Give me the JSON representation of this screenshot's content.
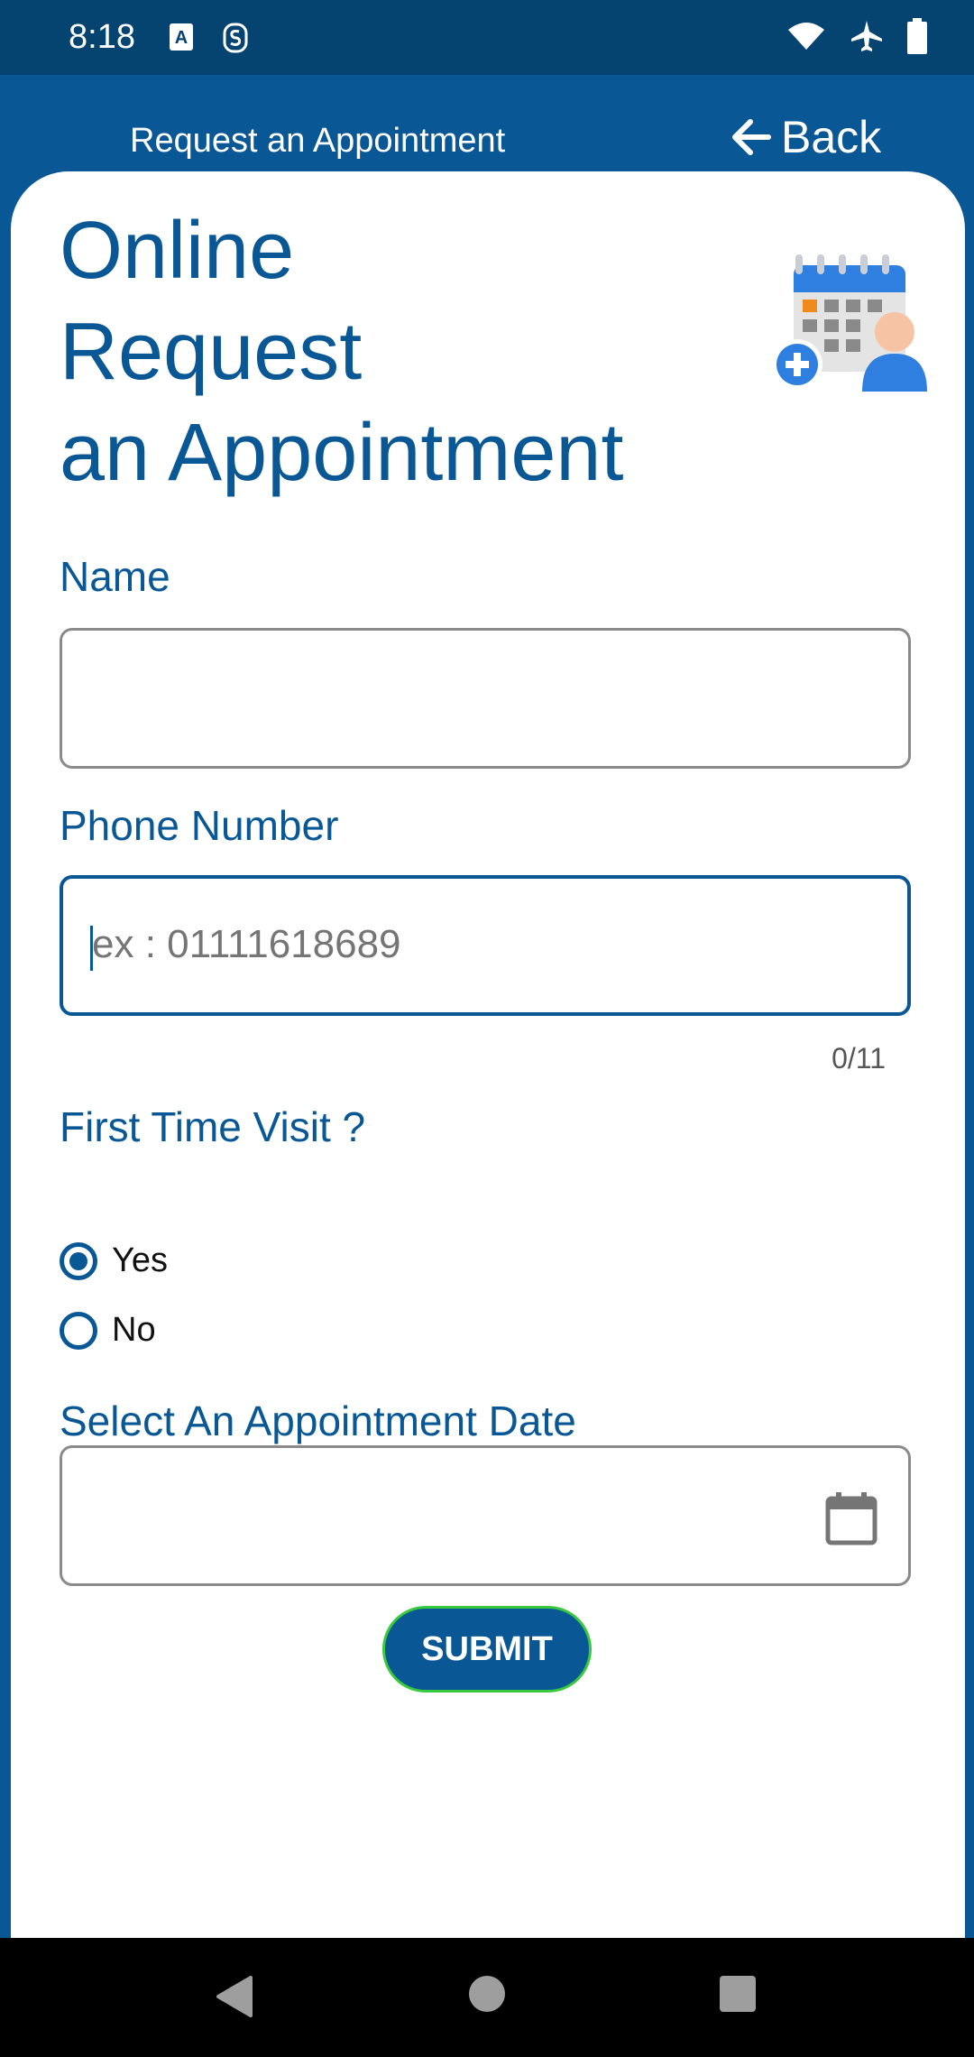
{
  "status_bar": {
    "time": "8:18",
    "left_icons": [
      "text-a-icon",
      "notification-s-icon"
    ],
    "right_icons": [
      "wifi-icon",
      "airplane-icon",
      "battery-icon"
    ]
  },
  "app_bar": {
    "title": "Request an Appointment",
    "back_label": "Back",
    "back_icon": "arrow-left-icon"
  },
  "heading": {
    "line1": "Online",
    "line2": "Request",
    "line3": "an Appointment",
    "illustration_icon": "calendar-person-add-icon"
  },
  "form": {
    "name": {
      "label": "Name",
      "value": ""
    },
    "phone": {
      "label": "Phone Number",
      "placeholder": "ex : 01111618689",
      "counter": "0/11"
    },
    "first_visit": {
      "label": "First Time Visit ?",
      "options": [
        {
          "label": "Yes",
          "checked": true
        },
        {
          "label": "No",
          "checked": false
        }
      ]
    },
    "date": {
      "label": "Select An Appointment Date",
      "value": "",
      "icon": "calendar-icon"
    },
    "submit_label": "SUBMIT"
  },
  "colors": {
    "primary": "#0a5796",
    "status_bar": "#054371",
    "submit_border": "#38c93e"
  },
  "nav_bar": {
    "icons": [
      "back-triangle-icon",
      "home-circle-icon",
      "recents-square-icon"
    ]
  }
}
